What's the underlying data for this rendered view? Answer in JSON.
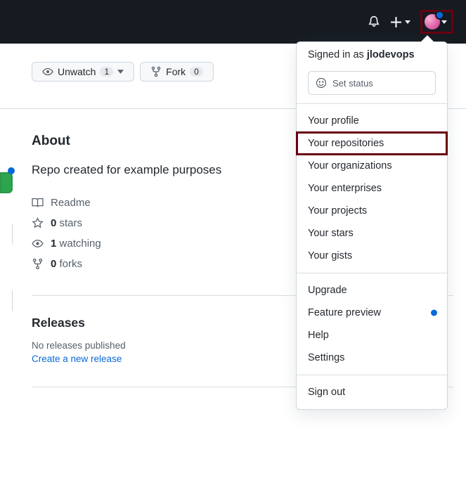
{
  "header": {
    "notification_icon": "bell",
    "add_icon": "plus"
  },
  "actions": {
    "unwatch": {
      "label": "Unwatch",
      "count": "1"
    },
    "fork": {
      "label": "Fork",
      "count": "0"
    }
  },
  "about": {
    "heading": "About",
    "description": "Repo created for example purposes",
    "readme": "Readme",
    "stars": {
      "count": "0",
      "label": "stars"
    },
    "watching": {
      "count": "1",
      "label": "watching"
    },
    "forks": {
      "count": "0",
      "label": "forks"
    }
  },
  "releases": {
    "heading": "Releases",
    "empty": "No releases published",
    "create_link": "Create a new release"
  },
  "dropdown": {
    "signed_in_prefix": "Signed in as ",
    "username": "jlodevops",
    "set_status": "Set status",
    "group1": [
      "Your profile",
      "Your repositories",
      "Your organizations",
      "Your enterprises",
      "Your projects",
      "Your stars",
      "Your gists"
    ],
    "group2": [
      "Upgrade",
      "Feature preview",
      "Help",
      "Settings"
    ],
    "highlighted": "Your repositories",
    "feature_preview": "Feature preview",
    "sign_out": "Sign out"
  }
}
